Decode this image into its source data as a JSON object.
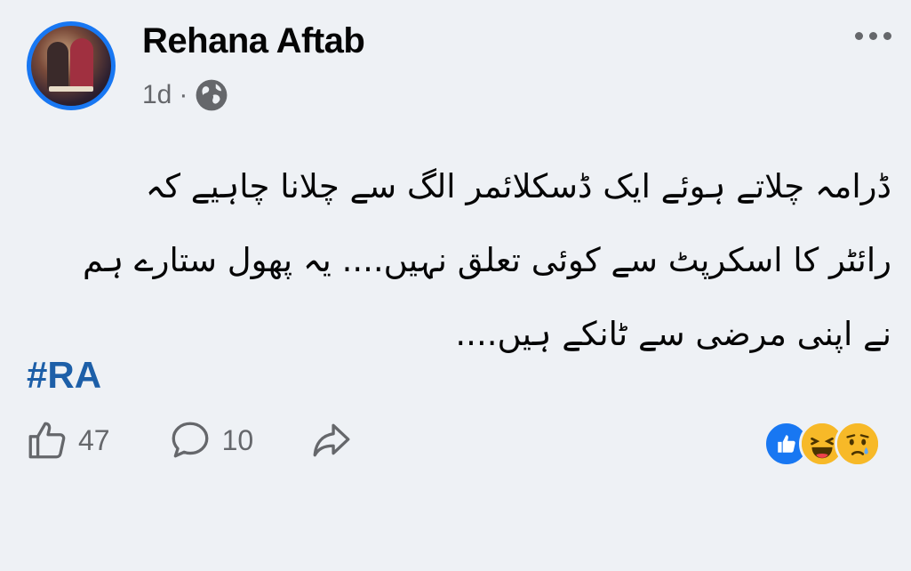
{
  "post": {
    "author": "Rehana Aftab",
    "timestamp": "1d",
    "separator": "·",
    "privacy_icon": "globe-icon",
    "text_lines": [
      "ڈرامہ چلاتے ہوئے ایک ڈسکلائمر الگ سے چلانا چاہیے کہ",
      "رائٹر کا اسکرپٹ سے کوئی تعلق نہیں.... یہ پھول ستارے ہم",
      "نے اپنی مرضی سے ٹانکے ہیں...."
    ],
    "hashtag": "#RA"
  },
  "actions": {
    "like_count": "47",
    "comment_count": "10"
  },
  "reactions": [
    "like-icon",
    "haha-icon",
    "sad-icon"
  ],
  "colors": {
    "accent": "#1877f2",
    "hashtag": "#1d5fa8",
    "secondary_text": "#65676b",
    "background": "#eef1f5"
  }
}
